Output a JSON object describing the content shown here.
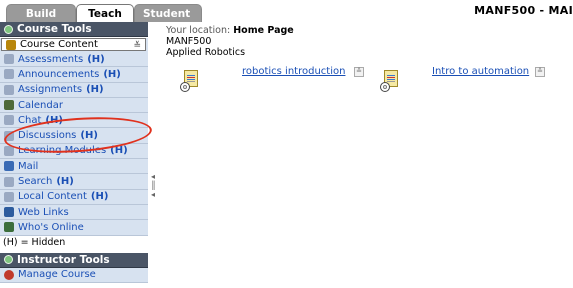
{
  "tabs": {
    "build": "Build",
    "teach": "Teach",
    "student_view": "Student View"
  },
  "course_title": "MANF500 - MAI",
  "sidebar": {
    "course_tools_header": "Course Tools",
    "items": [
      {
        "label": "Course Content",
        "hidden_marker": "",
        "icon": "course-content-icon",
        "color": "#b8860b"
      },
      {
        "label": "Assessments",
        "hidden_marker": "(H)",
        "icon": "assessments-icon",
        "color": "#9aa9c2"
      },
      {
        "label": "Announcements",
        "hidden_marker": "(H)",
        "icon": "announcements-icon",
        "color": "#9aa9c2"
      },
      {
        "label": "Assignments",
        "hidden_marker": "(H)",
        "icon": "assignments-icon",
        "color": "#9aa9c2"
      },
      {
        "label": "Calendar",
        "hidden_marker": "",
        "icon": "calendar-icon",
        "color": "#4e6a3a"
      },
      {
        "label": "Chat",
        "hidden_marker": "(H)",
        "icon": "chat-icon",
        "color": "#9aa9c2"
      },
      {
        "label": "Discussions",
        "hidden_marker": "(H)",
        "icon": "discussions-icon",
        "color": "#9aa9c2"
      },
      {
        "label": "Learning Modules",
        "hidden_marker": "(H)",
        "icon": "learning-modules-icon",
        "color": "#9aa9c2"
      },
      {
        "label": "Mail",
        "hidden_marker": "",
        "icon": "mail-icon",
        "color": "#3a6bb5"
      },
      {
        "label": "Search",
        "hidden_marker": "(H)",
        "icon": "search-icon",
        "color": "#9aa9c2"
      },
      {
        "label": "Local Content",
        "hidden_marker": "(H)",
        "icon": "local-content-icon",
        "color": "#9aa9c2"
      },
      {
        "label": "Web Links",
        "hidden_marker": "",
        "icon": "web-links-icon",
        "color": "#2d5c9e"
      },
      {
        "label": "Who's Online",
        "hidden_marker": "",
        "icon": "whos-online-icon",
        "color": "#3c6e3c"
      }
    ],
    "hidden_note": "(H) = Hidden",
    "instructor_tools_header": "Instructor Tools",
    "instructor_items": [
      {
        "label": "Manage Course",
        "icon": "manage-course-icon",
        "color": "#c0392b"
      }
    ]
  },
  "main": {
    "location_label": "Your location:",
    "location_page": "Home Page",
    "course_code": "MANF500",
    "course_name": "Applied Robotics",
    "content_items": [
      {
        "title": "robotics introduction",
        "icon": "file-icon"
      },
      {
        "title": "Intro to automation",
        "icon": "file-icon"
      }
    ]
  },
  "colors": {
    "sidebar_bg": "#d7e2f0",
    "header_bg": "#4a5566",
    "link": "#1a4fb5",
    "annotation": "#e0311d"
  }
}
